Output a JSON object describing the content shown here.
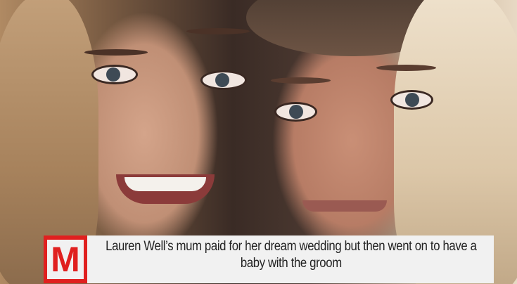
{
  "caption": {
    "logo_letter": "M",
    "text": "Lauren Well’s mum paid for her dream wedding but then went on to have a baby with the groom"
  },
  "colors": {
    "logo_red": "#e0201f",
    "caption_bg": "#f1f1f1"
  }
}
